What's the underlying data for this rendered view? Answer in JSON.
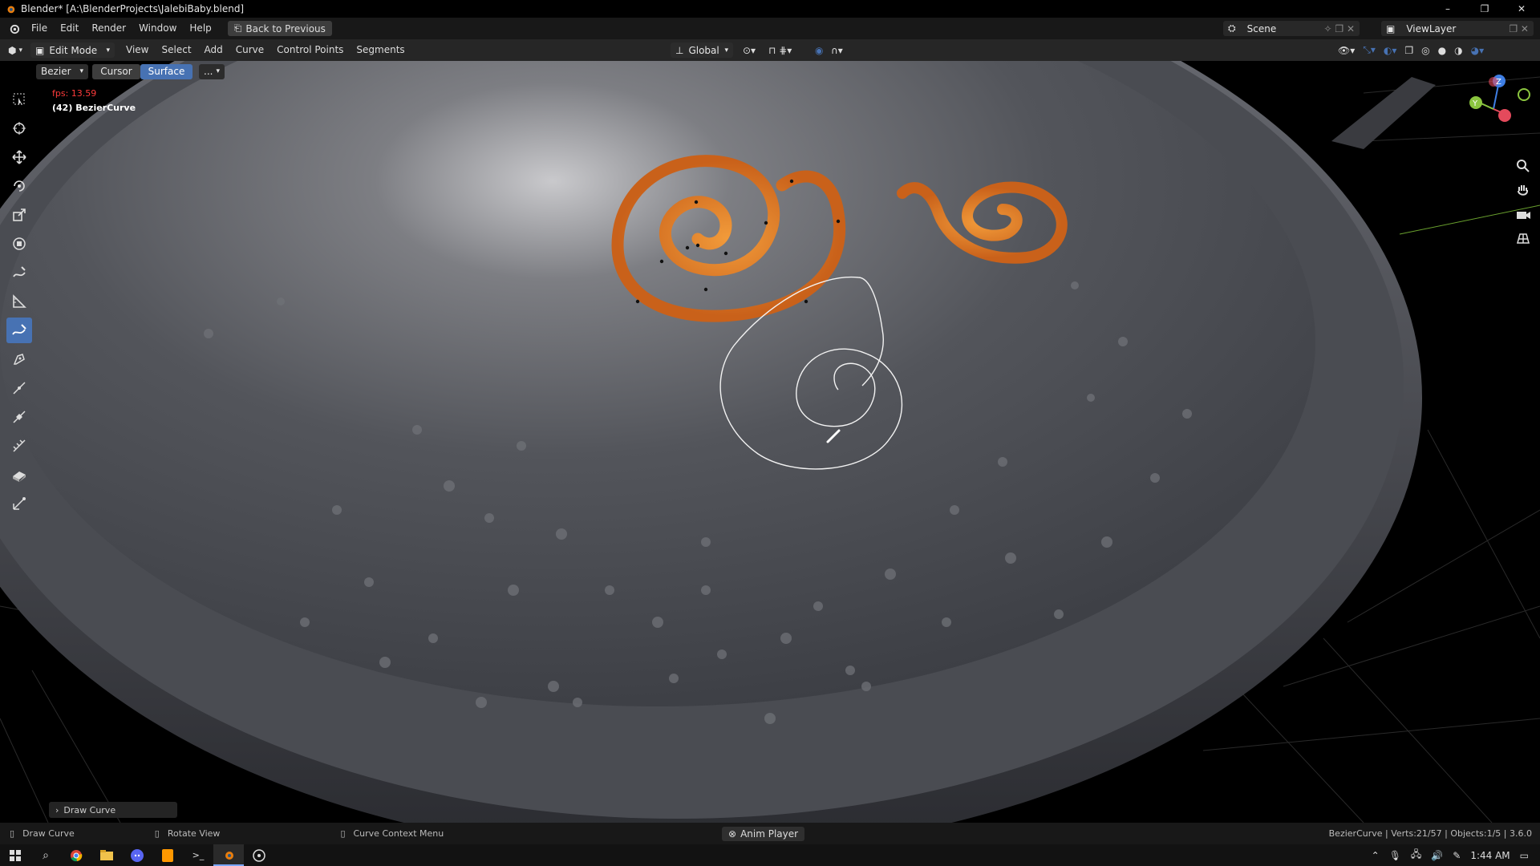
{
  "window": {
    "title": "Blender* [A:\\BlenderProjects\\JalebiBaby.blend]",
    "minimize": "–",
    "restore": "❐",
    "close": "✕"
  },
  "menubar": {
    "items": [
      "File",
      "Edit",
      "Render",
      "Window",
      "Help"
    ],
    "back_button": "Back to Previous",
    "scene": "Scene",
    "view_layer": "ViewLayer"
  },
  "header": {
    "mode": "Edit Mode",
    "menus": [
      "View",
      "Select",
      "Add",
      "Curve",
      "Control Points",
      "Segments"
    ],
    "orientation": "Global"
  },
  "tool_options": {
    "curve_type": "Bezier",
    "depth_options": [
      "Cursor",
      "Surface"
    ],
    "active_depth": "Surface",
    "more": "..."
  },
  "viewport": {
    "fps": "fps: 13.59",
    "object_info": "(42) BezierCurve",
    "gizmo_axes": [
      "Z",
      "Y"
    ],
    "last_op_panel": "Draw Curve"
  },
  "statusbar": {
    "left": "Draw Curve",
    "middle": "Rotate View",
    "context": "Curve Context Menu",
    "anim_player": "Anim Player",
    "stats": "BezierCurve | Verts:21/57 | Objects:1/5 | 3.6.0"
  },
  "taskbar": {
    "time": "1:44 AM"
  },
  "colors": {
    "accent": "#4772b3",
    "fps_red": "#ff3b3b",
    "jalebi": "#e07b1f",
    "gizmo_x": "#e44a5c",
    "gizmo_y": "#8bc53f",
    "gizmo_z": "#3f7fe4"
  },
  "toolbar_icons": [
    "select-box-icon",
    "cursor-icon",
    "move-icon",
    "rotate-icon",
    "scale-icon",
    "transform-icon",
    "annotate-icon",
    "measure-icon",
    "draw-curve-icon",
    "pen-icon",
    "tweak-icon",
    "radius-icon",
    "tilt-icon",
    "extrude-icon",
    "randomize-icon"
  ]
}
